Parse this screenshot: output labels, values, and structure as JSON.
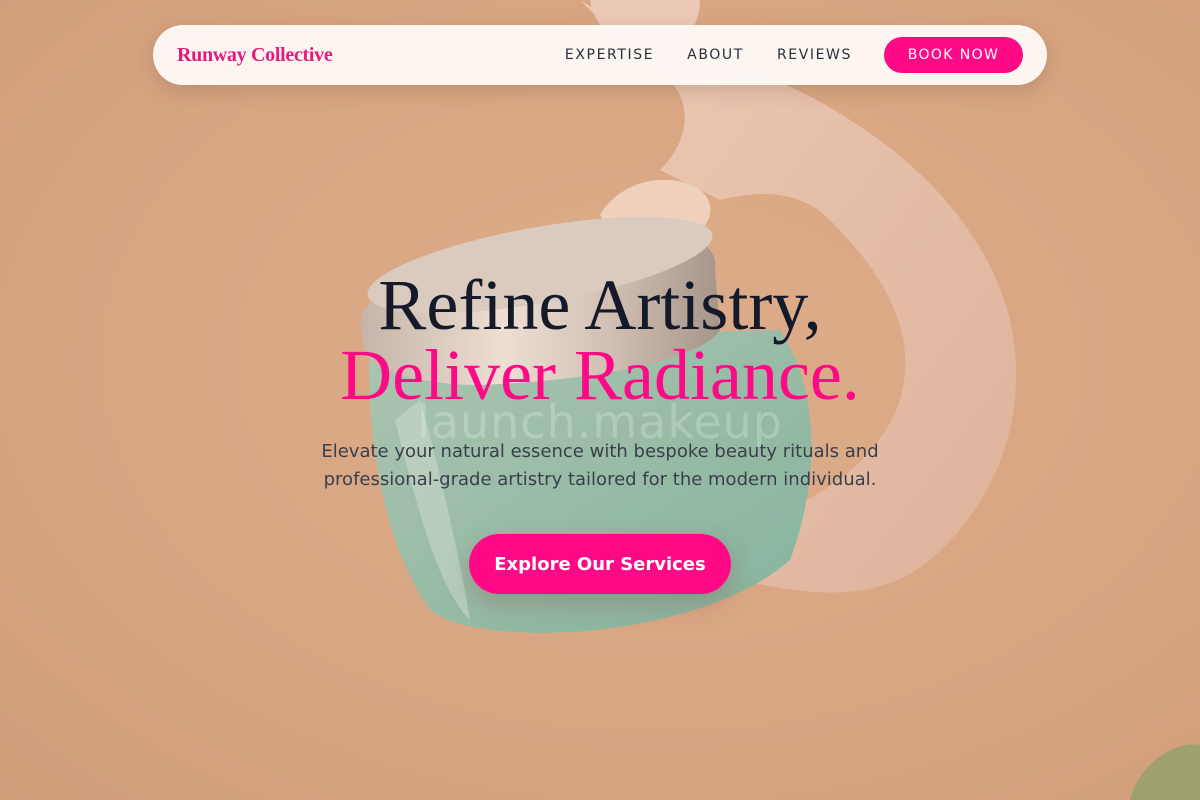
{
  "nav": {
    "brand": "Runway Collective",
    "links": [
      "EXPERTISE",
      "ABOUT",
      "REVIEWS"
    ],
    "book_label": "BOOK NOW"
  },
  "hero": {
    "headline_line1": "Refine Artistry,",
    "headline_line2": "Deliver Radiance.",
    "subtext": "Elevate your natural essence with bespoke beauty rituals and professional-grade artistry tailored for the modern individual.",
    "cta_label": "Explore Our Services",
    "watermark": "launch.makeup"
  },
  "colors": {
    "accent": "#ff0a86",
    "brand": "#e5197e",
    "heading": "#151a2a",
    "background": "#d6a37f"
  },
  "background_image": {
    "subject_icon": "hand-holding-jar-image"
  }
}
